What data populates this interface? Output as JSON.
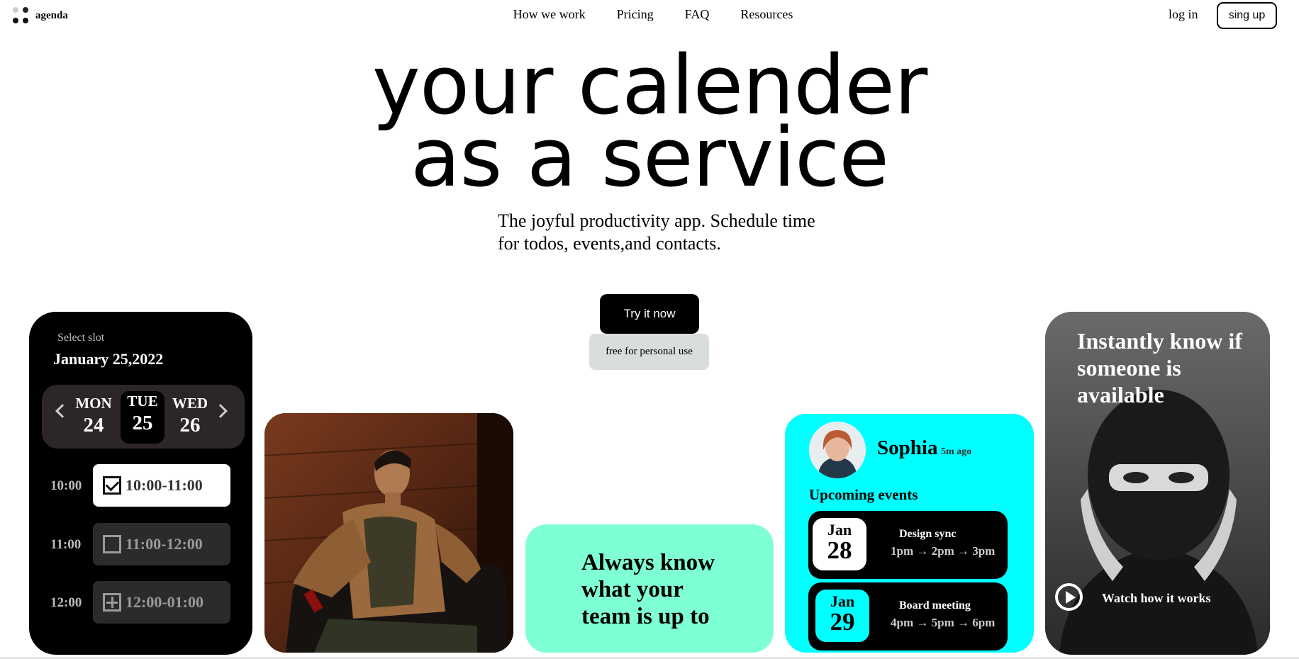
{
  "brand": {
    "name": "agenda"
  },
  "nav": {
    "items": [
      "How we work",
      "Pricing",
      "FAQ",
      "Resources"
    ],
    "login": "log in",
    "signup": "sing up"
  },
  "hero": {
    "title_line1": "your calender",
    "title_line2": "as a service",
    "subtitle": "The joyful productivity app. Schedule time for todos, events,and contacts.",
    "cta": "Try it now",
    "cta_note": "free for personal use"
  },
  "calendar_card": {
    "label": "Select slot",
    "date": "January 25,2022",
    "days": [
      {
        "name": "MON",
        "num": "24"
      },
      {
        "name": "TUE",
        "num": "25"
      },
      {
        "name": "WED",
        "num": "26"
      }
    ],
    "slots": [
      {
        "time": "10:00",
        "range": "10:00-11:00"
      },
      {
        "time": "11:00",
        "range": "11:00-12:00"
      },
      {
        "time": "12:00",
        "range": "12:00-01:00"
      }
    ]
  },
  "mint_card": {
    "text": "Always know what your team is up to"
  },
  "events_card": {
    "name": "Sophia",
    "time_ago": "5m ago",
    "heading": "Upcoming events",
    "events": [
      {
        "month": "Jan",
        "day": "28",
        "title": "Design sync",
        "times": "1pm → 2pm → 3pm"
      },
      {
        "month": "Jan",
        "day": "29",
        "title": "Board meeting",
        "times": "4pm → 5pm → 6pm"
      }
    ]
  },
  "bw_card": {
    "title": "Instantly know if someone is available",
    "action": "Watch how it works"
  },
  "colors": {
    "mint": "#7fffd4",
    "cyan": "#00ffff",
    "dark": "#000000"
  }
}
